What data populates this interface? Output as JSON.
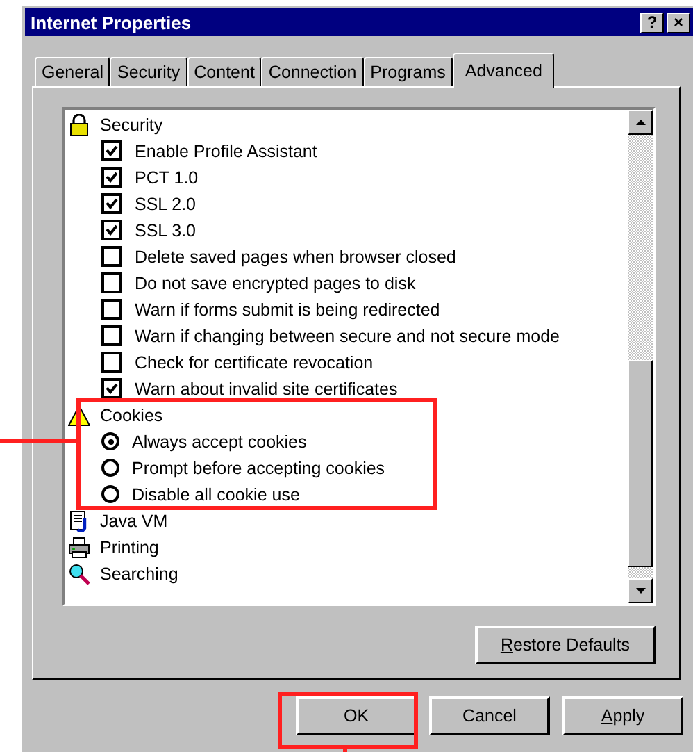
{
  "window": {
    "title": "Internet Properties",
    "help_button": "?",
    "close_button": "×"
  },
  "tabs": [
    {
      "label": "General",
      "selected": false
    },
    {
      "label": "Security",
      "selected": false
    },
    {
      "label": "Content",
      "selected": false
    },
    {
      "label": "Connection",
      "selected": false
    },
    {
      "label": "Programs",
      "selected": false
    },
    {
      "label": "Advanced",
      "selected": true
    }
  ],
  "settings": [
    {
      "label": "Security",
      "children": [
        {
          "kind": "checkbox",
          "label": "Enable Profile Assistant",
          "checked": true
        },
        {
          "kind": "checkbox",
          "label": "PCT 1.0",
          "checked": true
        },
        {
          "kind": "checkbox",
          "label": "SSL 2.0",
          "checked": true
        },
        {
          "kind": "checkbox",
          "label": "SSL 3.0",
          "checked": true
        },
        {
          "kind": "checkbox",
          "label": "Delete saved pages when browser closed",
          "checked": false
        },
        {
          "kind": "checkbox",
          "label": "Do not save encrypted pages to disk",
          "checked": false
        },
        {
          "kind": "checkbox",
          "label": "Warn if forms submit is being redirected",
          "checked": false
        },
        {
          "kind": "checkbox",
          "label": "Warn if changing between secure and not secure mode",
          "checked": false
        },
        {
          "kind": "checkbox",
          "label": "Check for certificate revocation",
          "checked": false
        },
        {
          "kind": "checkbox",
          "label": "Warn about invalid site certificates",
          "checked": true
        }
      ]
    },
    {
      "label": "Cookies",
      "children": [
        {
          "kind": "radio",
          "label": "Always accept cookies",
          "selected": true
        },
        {
          "kind": "radio",
          "label": "Prompt before accepting cookies",
          "selected": false
        },
        {
          "kind": "radio",
          "label": "Disable all cookie use",
          "selected": false
        }
      ]
    },
    {
      "label": "Java VM"
    },
    {
      "label": "Printing"
    },
    {
      "label": "Searching"
    }
  ],
  "restore_button": "Restore Defaults",
  "buttons": [
    "OK",
    "Cancel",
    "Apply"
  ]
}
